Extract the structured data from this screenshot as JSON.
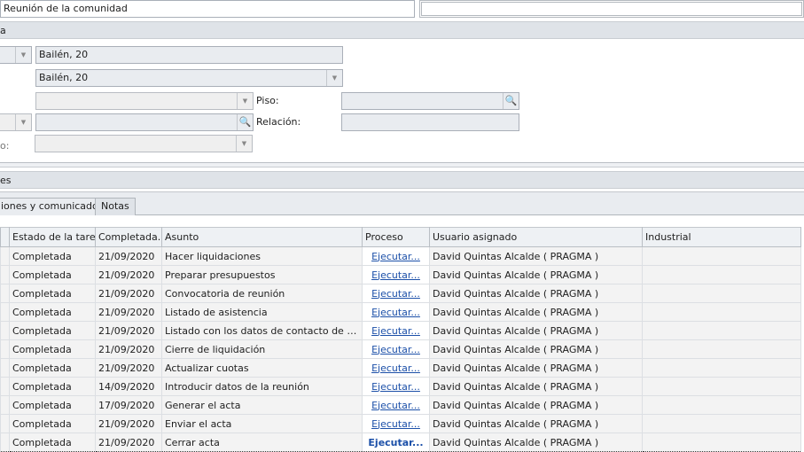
{
  "header": {
    "title_value": "Reunión de la comunidad",
    "section1_label": "a",
    "section2_label": "es"
  },
  "form": {
    "field1": "Bailén, 20",
    "field2": "Bailén, 20",
    "piso_label": "Piso:",
    "relacion_label": "Relación:",
    "partial_label": "o:"
  },
  "tabs": [
    {
      "label": "iones y comunicados"
    },
    {
      "label": "Notas"
    }
  ],
  "grid": {
    "columns": [
      "",
      "Estado de la tarea",
      "Completada...",
      "Asunto",
      "Proceso",
      "Usuario asignado",
      "Industrial"
    ],
    "rows": [
      {
        "estado": "Completada",
        "fecha": "21/09/2020",
        "asunto": "Hacer liquidaciones",
        "proceso": "Ejecutar...",
        "usuario": "David Quintas Alcalde ( PRAGMA )",
        "industrial": ""
      },
      {
        "estado": "Completada",
        "fecha": "21/09/2020",
        "asunto": "Preparar presupuestos",
        "proceso": "Ejecutar...",
        "usuario": "David Quintas Alcalde ( PRAGMA )",
        "industrial": ""
      },
      {
        "estado": "Completada",
        "fecha": "21/09/2020",
        "asunto": "Convocatoria de reunión",
        "proceso": "Ejecutar...",
        "usuario": "David Quintas Alcalde ( PRAGMA )",
        "industrial": ""
      },
      {
        "estado": "Completada",
        "fecha": "21/09/2020",
        "asunto": "Listado de asistencia",
        "proceso": "Ejecutar...",
        "usuario": "David Quintas Alcalde ( PRAGMA )",
        "industrial": ""
      },
      {
        "estado": "Completada",
        "fecha": "21/09/2020",
        "asunto": "Listado con los datos de contacto de los pr...",
        "proceso": "Ejecutar...",
        "usuario": "David Quintas Alcalde ( PRAGMA )",
        "industrial": ""
      },
      {
        "estado": "Completada",
        "fecha": "21/09/2020",
        "asunto": "Cierre de liquidación",
        "proceso": "Ejecutar...",
        "usuario": "David Quintas Alcalde ( PRAGMA )",
        "industrial": ""
      },
      {
        "estado": "Completada",
        "fecha": "21/09/2020",
        "asunto": "Actualizar cuotas",
        "proceso": "Ejecutar...",
        "usuario": "David Quintas Alcalde ( PRAGMA )",
        "industrial": ""
      },
      {
        "estado": "Completada",
        "fecha": "14/09/2020",
        "asunto": "Introducir datos de la reunión",
        "proceso": "Ejecutar...",
        "usuario": "David Quintas Alcalde ( PRAGMA )",
        "industrial": ""
      },
      {
        "estado": "Completada",
        "fecha": "17/09/2020",
        "asunto": "Generar el acta",
        "proceso": "Ejecutar...",
        "usuario": "David Quintas Alcalde ( PRAGMA )",
        "industrial": ""
      },
      {
        "estado": "Completada",
        "fecha": "21/09/2020",
        "asunto": "Enviar el acta",
        "proceso": "Ejecutar...",
        "usuario": "David Quintas Alcalde ( PRAGMA )",
        "industrial": ""
      },
      {
        "estado": "Completada",
        "fecha": "21/09/2020",
        "asunto": "Cerrar acta",
        "proceso": "Ejecutar...",
        "usuario": "David Quintas Alcalde ( PRAGMA )",
        "industrial": ""
      }
    ]
  }
}
